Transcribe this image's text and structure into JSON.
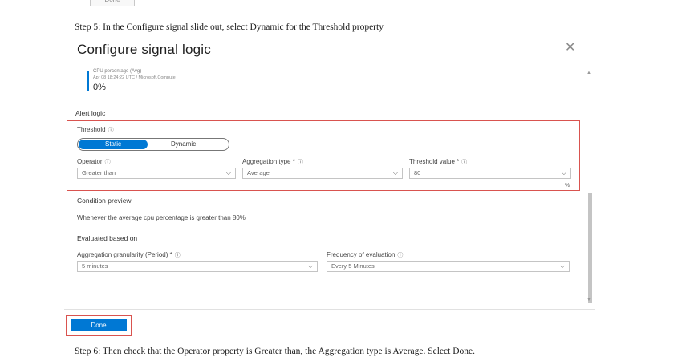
{
  "previous_button": {
    "label": "Done"
  },
  "instructions": {
    "step5": "Step 5: In the Configure signal slide out, select Dynamic for the Threshold property",
    "step6": "Step 6: Then check that the Operator property is Greater than, the Aggregation type is Average. Select Done."
  },
  "panel": {
    "title": "Configure signal logic",
    "close_icon": "close-icon",
    "signal": {
      "name": "CPU percentage (Avg)",
      "subtitle": "Apr 08 18:24:22 UTC / Microsoft.Compute",
      "value": "0%"
    },
    "alert_logic": {
      "heading": "Alert logic",
      "threshold": {
        "label": "Threshold",
        "options": [
          "Static",
          "Dynamic"
        ],
        "selected": "Static"
      },
      "operator": {
        "label": "Operator",
        "value": "Greater than"
      },
      "aggregation_type": {
        "label": "Aggregation type *",
        "value": "Average"
      },
      "threshold_value": {
        "label": "Threshold value *",
        "value": "80",
        "unit": "%"
      }
    },
    "condition_preview": {
      "heading": "Condition preview",
      "text": "Whenever the average cpu percentage is greater than 80%"
    },
    "evaluated_based_on": {
      "heading": "Evaluated based on",
      "aggregation_granularity": {
        "label": "Aggregation granularity (Period) *",
        "value": "5 minutes"
      },
      "frequency": {
        "label": "Frequency of evaluation",
        "value": "Every 5 Minutes"
      }
    },
    "done_button": {
      "label": "Done"
    }
  },
  "colors": {
    "accent": "#0078d4",
    "highlight": "#d9534f"
  }
}
